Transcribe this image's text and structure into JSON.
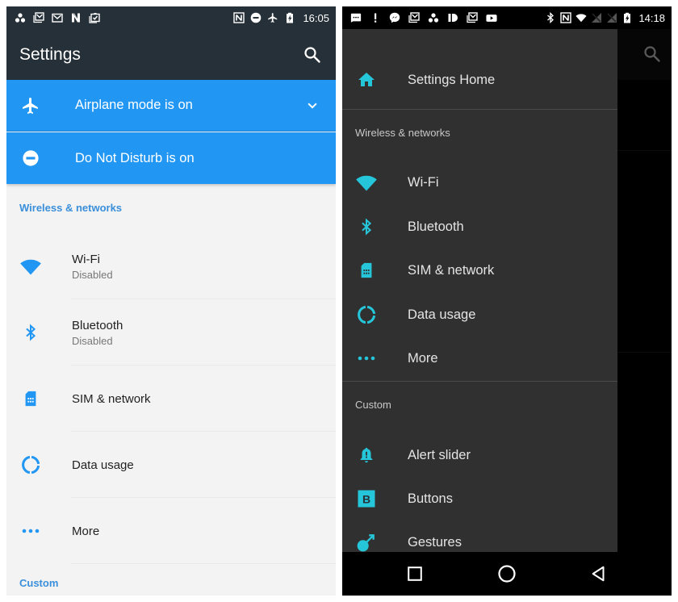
{
  "left_screen": {
    "status_bar": {
      "notification_icons": [
        "cluster-icon",
        "gmail-stack-icon",
        "gmail-icon",
        "n-logo-icon",
        "clipboard-check-icon"
      ],
      "system_icons": [
        "nfc-icon",
        "do-not-disturb-icon",
        "airplane-icon",
        "battery-charging-icon"
      ],
      "time": "16:05"
    },
    "app_bar": {
      "title": "Settings",
      "search_icon": "search-icon"
    },
    "conditions": [
      {
        "icon": "airplane-icon",
        "label": "Airplane mode is on",
        "expand_icon": "chevron-down-icon"
      },
      {
        "icon": "do-not-disturb-icon",
        "label": "Do Not Disturb is on"
      }
    ],
    "sections": [
      {
        "header": "Wireless & networks",
        "items": [
          {
            "icon": "wifi-icon",
            "title": "Wi-Fi",
            "subtitle": "Disabled"
          },
          {
            "icon": "bluetooth-icon",
            "title": "Bluetooth",
            "subtitle": "Disabled"
          },
          {
            "icon": "sim-card-icon",
            "title": "SIM & network"
          },
          {
            "icon": "data-usage-icon",
            "title": "Data usage"
          },
          {
            "icon": "more-icon",
            "title": "More"
          }
        ]
      },
      {
        "header": "Custom"
      }
    ],
    "colors": {
      "app_bar": "#263038",
      "condition_bg": "#2196f3",
      "accent": "#3a8fdb",
      "background": "#f3f3f3"
    }
  },
  "right_screen": {
    "status_bar": {
      "notification_icons": [
        "chat-bubble-icon",
        "alert-icon",
        "messenger-icon",
        "gmail-stack-icon",
        "cluster-icon",
        "patreon-icon",
        "gmail-stack-icon",
        "youtube-icon"
      ],
      "system_icons": [
        "bluetooth-icon",
        "nfc-icon",
        "wifi-icon",
        "no-signal-icon",
        "no-signal-icon",
        "battery-charging-icon"
      ],
      "time": "14:18"
    },
    "drawer": {
      "home": {
        "icon": "home-icon",
        "label": "Settings Home"
      },
      "sections": [
        {
          "header": "Wireless & networks",
          "items": [
            {
              "icon": "wifi-icon",
              "label": "Wi-Fi"
            },
            {
              "icon": "bluetooth-icon",
              "label": "Bluetooth"
            },
            {
              "icon": "sim-card-icon",
              "label": "SIM & network"
            },
            {
              "icon": "data-usage-icon",
              "label": "Data usage"
            },
            {
              "icon": "more-icon",
              "label": "More"
            }
          ]
        },
        {
          "header": "Custom",
          "items": [
            {
              "icon": "alert-slider-icon",
              "label": "Alert slider"
            },
            {
              "icon": "buttons-icon",
              "label": "Buttons",
              "glyph": "B"
            },
            {
              "icon": "gestures-icon",
              "label": "Gestures"
            }
          ]
        }
      ]
    },
    "nav_bar": [
      "recents-button",
      "home-button",
      "back-button"
    ],
    "colors": {
      "drawer_bg": "#303030",
      "accent": "#26c6da",
      "text": "#e4e4e4"
    }
  }
}
